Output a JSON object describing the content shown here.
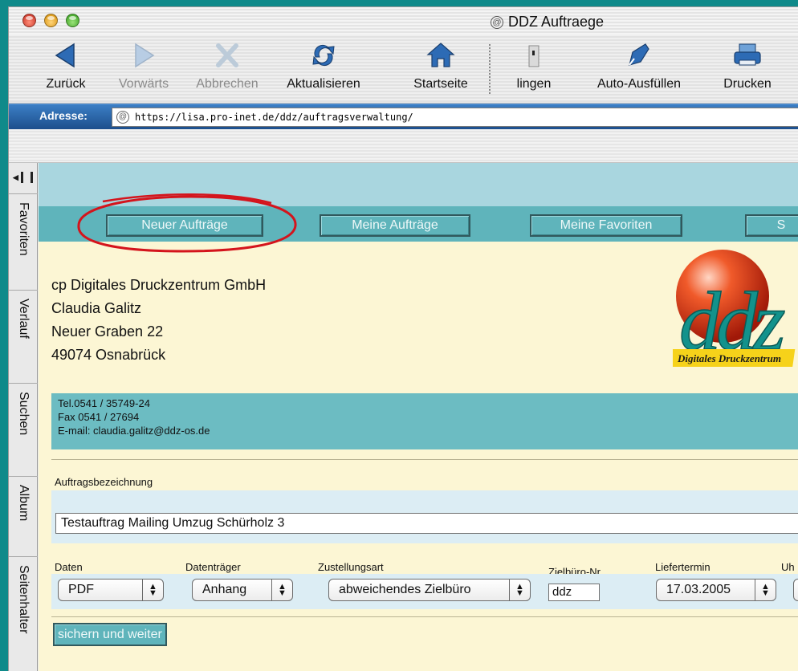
{
  "window": {
    "title": "DDZ Auftraege"
  },
  "toolbar": {
    "buttons": [
      {
        "label": "Zurück",
        "icon": "back-arrow-icon",
        "enabled": true
      },
      {
        "label": "Vorwärts",
        "icon": "forward-arrow-icon",
        "enabled": false
      },
      {
        "label": "Abbrechen",
        "icon": "stop-x-icon",
        "enabled": false
      },
      {
        "label": "Aktualisieren",
        "icon": "refresh-icon",
        "enabled": true
      },
      {
        "label": "Startseite",
        "icon": "home-icon",
        "enabled": true
      },
      {
        "label": "lingen",
        "icon": "partial-icon",
        "enabled": true
      },
      {
        "label": "Auto-Ausfüllen",
        "icon": "autofill-icon",
        "enabled": true
      },
      {
        "label": "Drucken",
        "icon": "printer-icon",
        "enabled": true
      }
    ]
  },
  "address_bar": {
    "label": "Adresse:",
    "url": "https://lisa.pro-inet.de/ddz/auftragsverwaltung/"
  },
  "sidebar": {
    "tabs": [
      "Favoriten",
      "Verlauf",
      "Suchen",
      "Album",
      "Seitenhalter"
    ]
  },
  "page": {
    "nav_buttons": [
      "Neuer Aufträge",
      "Meine Aufträge",
      "Meine Favoriten",
      "S"
    ],
    "company": {
      "name": "cp Digitales Druckzentrum GmbH",
      "contact": "Claudia Galitz",
      "street": "Neuer Graben 22",
      "city": "49074 Osnabrück"
    },
    "logo": {
      "mark": "ddz",
      "tagline": "Digitales Druckzentrum"
    },
    "contact_info": {
      "tel": "Tel.0541 / 35749-24",
      "fax": "Fax 0541 / 27694",
      "email": "E-mail: claudia.galitz@ddz-os.de"
    },
    "form": {
      "auftrag_label": "Auftragsbezeichnung",
      "auftrag_value": "Testauftrag Mailing Umzug Schürholz 3",
      "fields": {
        "daten": {
          "label": "Daten",
          "value": "PDF"
        },
        "datentraeger": {
          "label": "Datenträger",
          "value": "Anhang"
        },
        "zustellungsart": {
          "label": "Zustellungsart",
          "value": "abweichendes Zielbüro"
        },
        "zielbuero": {
          "label": "Zielbüro-Nr.",
          "value": "ddz"
        },
        "liefertermin": {
          "label": "Liefertermin",
          "value": "17.03.2005"
        },
        "uhrzeit": {
          "label": "Uh"
        }
      },
      "submit_label": "sichern und weiter"
    }
  },
  "colors": {
    "page_background": "#fcf6d4",
    "nav_band": "#5fb4bb",
    "top_band": "#a9d6df",
    "field_band": "#dcedf4",
    "annotation_red": "#d4141c",
    "address_bar": "#2a63a8"
  }
}
